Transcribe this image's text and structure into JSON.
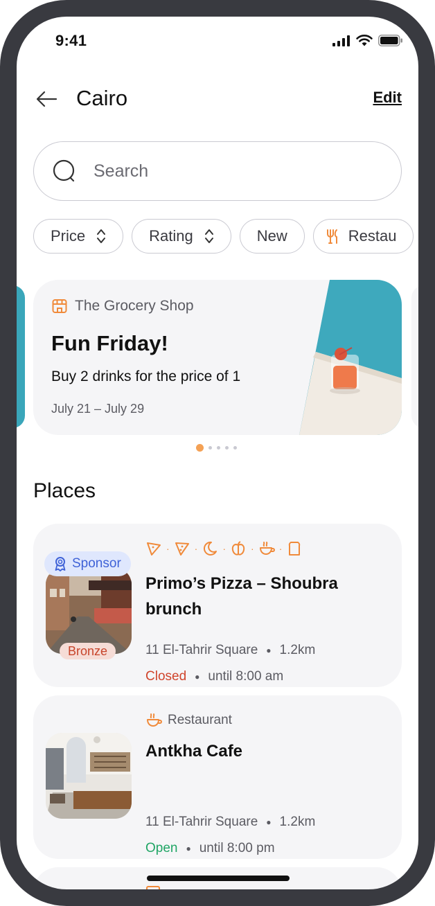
{
  "status_bar": {
    "time": "9:41"
  },
  "header": {
    "city": "Cairo",
    "edit_label": "Edit"
  },
  "search": {
    "placeholder": "Search",
    "value": ""
  },
  "filters": [
    {
      "label": "Price"
    },
    {
      "label": "Rating"
    },
    {
      "label": "New"
    },
    {
      "label": "Restau"
    }
  ],
  "promo": {
    "shop": "The Grocery Shop",
    "title": "Fun Friday!",
    "description": "Buy 2 drinks for the price of 1",
    "dates": "July 21 – July 29",
    "page_count": 5,
    "active_page": 1
  },
  "places_title": "Places",
  "places": [
    {
      "sponsor_label": "Sponsor",
      "tier": "Bronze",
      "name": "Primo’s Pizza – Shoubra brunch",
      "address": "11 El-Tahrir Square",
      "distance": "1.2km",
      "status": "Closed",
      "hours": "until 8:00 am",
      "category_icons": [
        "pizza-icon",
        "pizza-icon",
        "moon-icon",
        "apple-icon",
        "coffee-icon",
        "bread-icon"
      ]
    },
    {
      "category": "Restaurant",
      "name": "Antkha Cafe",
      "address": "11 El-Tahrir Square",
      "distance": "1.2km",
      "status": "Open",
      "hours": "until 8:00 pm"
    }
  ],
  "colors": {
    "accent_orange": "#f08a3a",
    "card_bg": "#f5f5f7",
    "sponsor_blue": "#3f62d7",
    "closed_red": "#d0442c",
    "open_green": "#20a565",
    "bezel": "#393a40"
  }
}
